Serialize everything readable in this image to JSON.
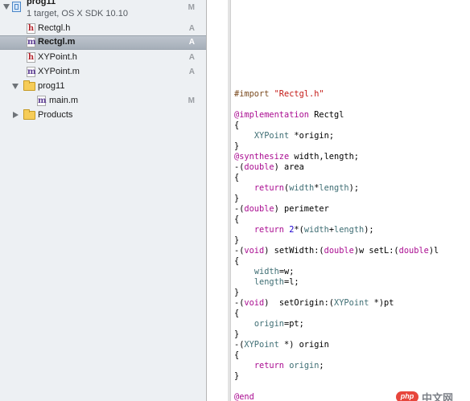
{
  "navigator": {
    "project": {
      "name": "prog11",
      "subtitle": "1 target, OS X SDK 10.10",
      "status": "M",
      "icon": "xcode-project-icon"
    },
    "items": [
      {
        "name": "Rectgl.h",
        "type": "header",
        "icon_glyph": "h",
        "status": "A",
        "selected": false
      },
      {
        "name": "Rectgl.m",
        "type": "impl",
        "icon_glyph": "m",
        "status": "A",
        "selected": true
      },
      {
        "name": "XYPoint.h",
        "type": "header",
        "icon_glyph": "h",
        "status": "A",
        "selected": false
      },
      {
        "name": "XYPoint.m",
        "type": "impl",
        "icon_glyph": "m",
        "status": "A",
        "selected": false
      },
      {
        "name": "prog11",
        "type": "group",
        "status": "",
        "expanded": true
      },
      {
        "name": "main.m",
        "type": "impl",
        "icon_glyph": "m",
        "status": "M",
        "selected": false
      },
      {
        "name": "Products",
        "type": "group",
        "status": "",
        "expanded": false
      }
    ]
  },
  "editor": {
    "file": "Rectgl.m",
    "lines": [
      [
        [
          "pp",
          "#import "
        ],
        [
          "str",
          "\"Rectgl.h\""
        ]
      ],
      [],
      [
        [
          "kw",
          "@implementation"
        ],
        [
          "plain",
          " Rectgl"
        ]
      ],
      [
        [
          "plain",
          "{"
        ]
      ],
      [
        [
          "plain",
          "    "
        ],
        [
          "type",
          "XYPoint"
        ],
        [
          "plain",
          " *origin;"
        ]
      ],
      [
        [
          "plain",
          "}"
        ]
      ],
      [
        [
          "kw",
          "@synthesize"
        ],
        [
          "plain",
          " width,length;"
        ]
      ],
      [
        [
          "plain",
          "-("
        ],
        [
          "kw",
          "double"
        ],
        [
          "plain",
          ") area"
        ]
      ],
      [
        [
          "plain",
          "{"
        ]
      ],
      [
        [
          "plain",
          "    "
        ],
        [
          "kw",
          "return"
        ],
        [
          "plain",
          "("
        ],
        [
          "ivar",
          "width"
        ],
        [
          "plain",
          "*"
        ],
        [
          "ivar",
          "length"
        ],
        [
          "plain",
          ");"
        ]
      ],
      [
        [
          "plain",
          "}"
        ]
      ],
      [
        [
          "plain",
          "-("
        ],
        [
          "kw",
          "double"
        ],
        [
          "plain",
          ") perimeter"
        ]
      ],
      [
        [
          "plain",
          "{"
        ]
      ],
      [
        [
          "plain",
          "    "
        ],
        [
          "kw",
          "return"
        ],
        [
          "plain",
          " "
        ],
        [
          "num",
          "2"
        ],
        [
          "plain",
          "*("
        ],
        [
          "ivar",
          "width"
        ],
        [
          "plain",
          "+"
        ],
        [
          "ivar",
          "length"
        ],
        [
          "plain",
          ");"
        ]
      ],
      [
        [
          "plain",
          "}"
        ]
      ],
      [
        [
          "plain",
          "-("
        ],
        [
          "kw",
          "void"
        ],
        [
          "plain",
          ") setWidth:("
        ],
        [
          "kw",
          "double"
        ],
        [
          "plain",
          ")w setL:("
        ],
        [
          "kw",
          "double"
        ],
        [
          "plain",
          ")l"
        ]
      ],
      [
        [
          "plain",
          "{"
        ]
      ],
      [
        [
          "plain",
          "    "
        ],
        [
          "ivar",
          "width"
        ],
        [
          "plain",
          "=w;"
        ]
      ],
      [
        [
          "plain",
          "    "
        ],
        [
          "ivar",
          "length"
        ],
        [
          "plain",
          "=l;"
        ]
      ],
      [
        [
          "plain",
          "}"
        ]
      ],
      [
        [
          "plain",
          "-("
        ],
        [
          "kw",
          "void"
        ],
        [
          "plain",
          ")  setOrigin:("
        ],
        [
          "type",
          "XYPoint"
        ],
        [
          "plain",
          " *)pt"
        ]
      ],
      [
        [
          "plain",
          "{"
        ]
      ],
      [
        [
          "plain",
          "    "
        ],
        [
          "ivar",
          "origin"
        ],
        [
          "plain",
          "=pt;"
        ]
      ],
      [
        [
          "plain",
          "}"
        ]
      ],
      [
        [
          "plain",
          "-("
        ],
        [
          "type",
          "XYPoint"
        ],
        [
          "plain",
          " *) origin"
        ]
      ],
      [
        [
          "plain",
          "{"
        ]
      ],
      [
        [
          "plain",
          "    "
        ],
        [
          "kw",
          "return"
        ],
        [
          "plain",
          " "
        ],
        [
          "ivar",
          "origin"
        ],
        [
          "plain",
          ";"
        ]
      ],
      [
        [
          "plain",
          "}"
        ]
      ],
      [],
      [
        [
          "kw",
          "@end"
        ]
      ]
    ]
  },
  "watermark": {
    "logo": "php",
    "text": "中文网"
  },
  "colors": {
    "keyword": "#aa0d91",
    "string": "#c41a16",
    "preprocessor": "#7a4a1e",
    "type": "#3f6e74",
    "number": "#1c00cf",
    "selection": "#a6afb9",
    "sidebar_bg": "#edf0f3"
  }
}
